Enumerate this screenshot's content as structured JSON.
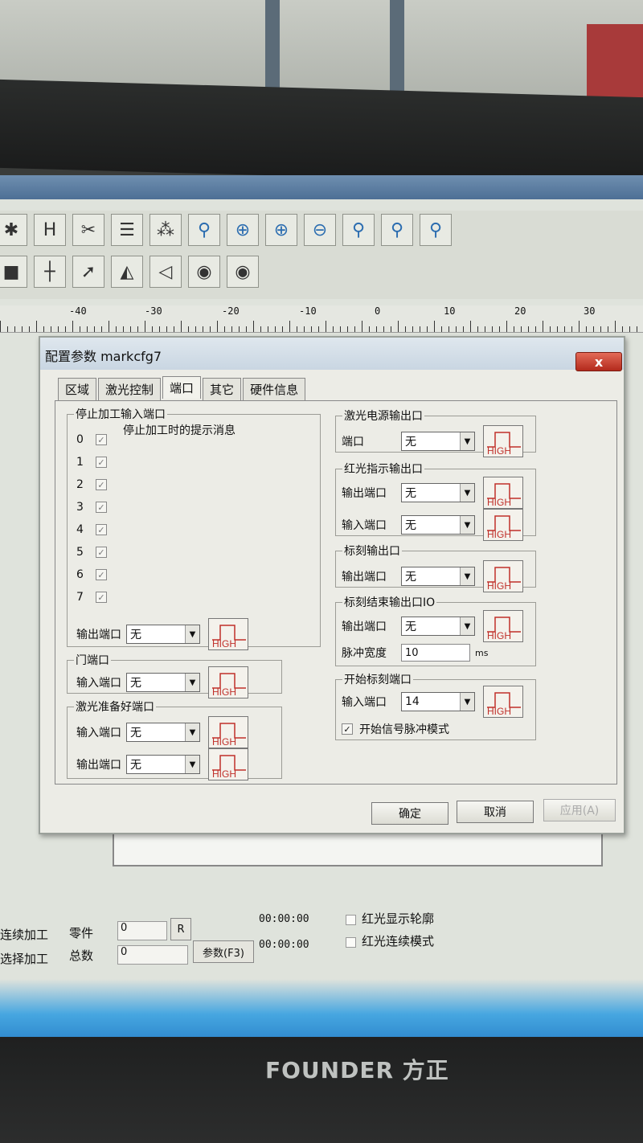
{
  "dialog": {
    "title": "配置参数 markcfg7",
    "close_label": "x",
    "tabs": [
      "区域",
      "激光控制",
      "端口",
      "其它",
      "硬件信息"
    ],
    "stop_group": {
      "legend": "停止加工输入端口",
      "message_label": "停止加工时的提示消息",
      "bits": [
        "0",
        "1",
        "2",
        "3",
        "4",
        "5",
        "6",
        "7"
      ],
      "output_label": "输出端口",
      "output_value": "无"
    },
    "door_group": {
      "legend": "门端口",
      "input_label": "输入端口",
      "input_value": "无"
    },
    "laser_ready_group": {
      "legend": "激光准备好端口",
      "input_label": "输入端口",
      "input_value": "无",
      "output_label": "输出端口",
      "output_value": "无"
    },
    "power_group": {
      "legend": "激光电源输出口",
      "port_label": "端口",
      "port_value": "无"
    },
    "red_group": {
      "legend": "红光指示输出口",
      "output_label": "输出端口",
      "output_value": "无",
      "input_label": "输入端口",
      "input_value": "无"
    },
    "mark_group": {
      "legend": "标刻输出口",
      "output_label": "输出端口",
      "output_value": "无"
    },
    "mark_end_group": {
      "legend": "标刻结束输出口IO",
      "output_label": "输出端口",
      "output_value": "无",
      "pulse_label": "脉冲宽度",
      "pulse_value": "10",
      "pulse_unit": "ms"
    },
    "start_group": {
      "legend": "开始标刻端口",
      "input_label": "输入端口",
      "input_value": "14",
      "pulse_mode_label": "开始信号脉冲模式"
    },
    "high_label": "HIGH",
    "buttons": {
      "ok": "确定",
      "cancel": "取消",
      "apply": "应用(A)"
    }
  },
  "ruler": {
    "labels": [
      "-40",
      "-30",
      "-20",
      "-10",
      "0",
      "10",
      "20",
      "30"
    ]
  },
  "status": {
    "continuous": "连续加工",
    "select": "选择加工",
    "parts_label": "零件",
    "total_label": "总数",
    "parts_value": "0",
    "total_value": "0",
    "r_button": "R",
    "params_button": "参数(F3)",
    "time1": "00:00:00",
    "time2": "00:00:00",
    "red_outline": "红光显示轮廓",
    "red_continuous": "红光连续模式"
  },
  "brand": {
    "text": "FOUNDER 方正"
  }
}
